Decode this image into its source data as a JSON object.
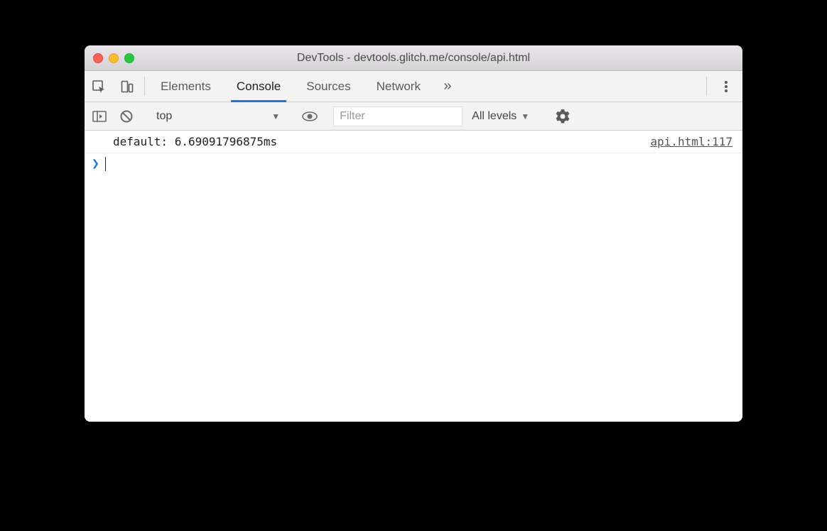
{
  "window": {
    "title": "DevTools - devtools.glitch.me/console/api.html"
  },
  "tabs": {
    "items": [
      "Elements",
      "Console",
      "Sources",
      "Network"
    ],
    "active_index": 1,
    "overflow_glyph": "»"
  },
  "toolbar": {
    "context": "top",
    "filter_placeholder": "Filter",
    "levels_label": "All levels"
  },
  "console": {
    "rows": [
      {
        "message": "default: 6.69091796875ms",
        "source": "api.html:117"
      }
    ],
    "prompt_glyph": "❯"
  }
}
